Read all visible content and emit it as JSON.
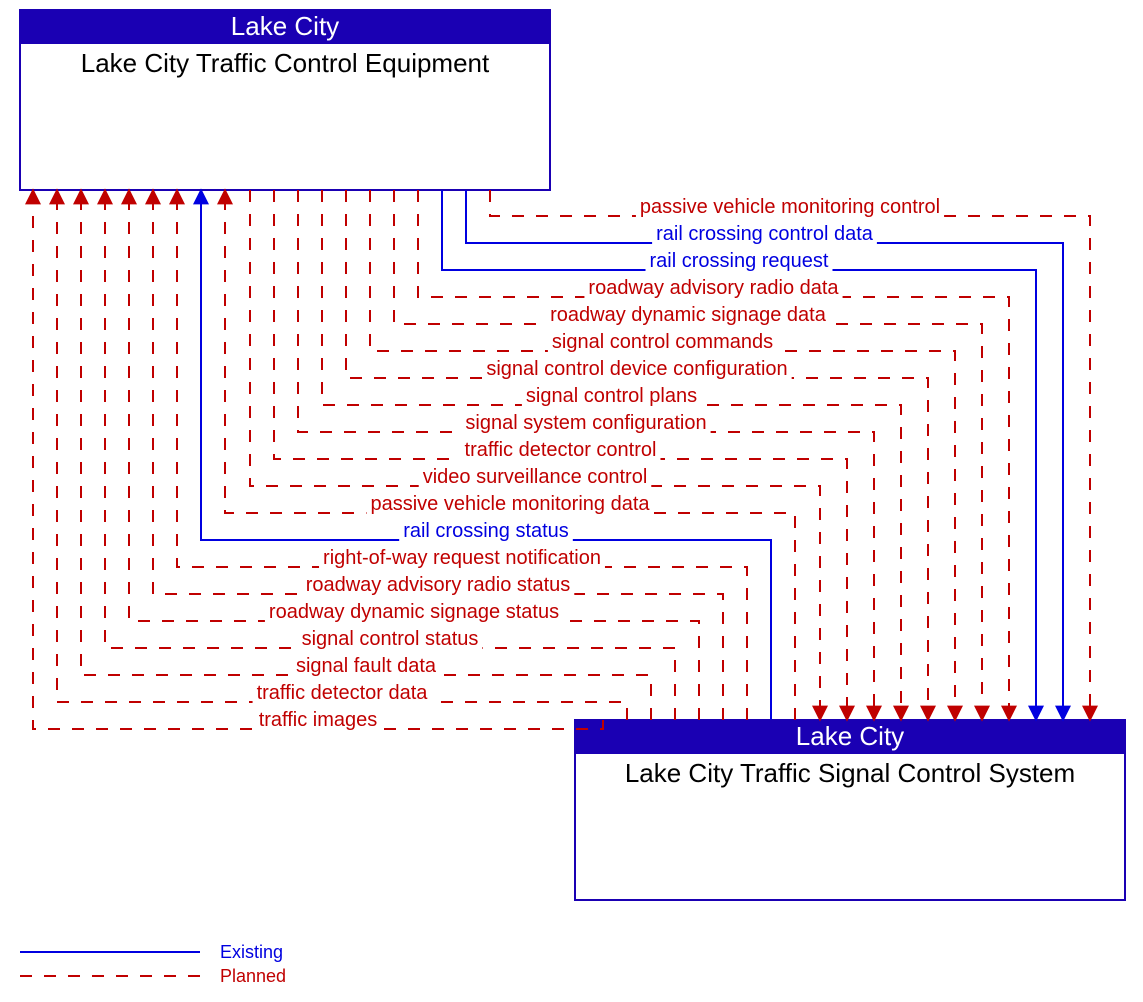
{
  "boxes": {
    "top": {
      "header": "Lake City",
      "body": "Lake City Traffic Control Equipment"
    },
    "bottom": {
      "header": "Lake City",
      "body": "Lake City Traffic Signal Control System"
    }
  },
  "flows_down": [
    {
      "label": "passive vehicle monitoring control",
      "status": "planned"
    },
    {
      "label": "rail crossing control data",
      "status": "existing"
    },
    {
      "label": "rail crossing request",
      "status": "existing"
    },
    {
      "label": "roadway advisory radio data",
      "status": "planned"
    },
    {
      "label": "roadway dynamic signage data",
      "status": "planned"
    },
    {
      "label": "signal control commands",
      "status": "planned"
    },
    {
      "label": "signal control device configuration",
      "status": "planned"
    },
    {
      "label": "signal control plans",
      "status": "planned"
    },
    {
      "label": "signal system configuration",
      "status": "planned"
    },
    {
      "label": "traffic detector control",
      "status": "planned"
    },
    {
      "label": "video surveillance control",
      "status": "planned"
    }
  ],
  "flows_up": [
    {
      "label": "passive vehicle monitoring data",
      "status": "planned"
    },
    {
      "label": "rail crossing status",
      "status": "existing"
    },
    {
      "label": "right-of-way request notification",
      "status": "planned"
    },
    {
      "label": "roadway advisory radio status",
      "status": "planned"
    },
    {
      "label": "roadway dynamic signage status",
      "status": "planned"
    },
    {
      "label": "signal control status",
      "status": "planned"
    },
    {
      "label": "signal fault data",
      "status": "planned"
    },
    {
      "label": "traffic detector data",
      "status": "planned"
    },
    {
      "label": "traffic images",
      "status": "planned"
    }
  ],
  "legend": {
    "existing": "Existing",
    "planned": "Planned"
  }
}
